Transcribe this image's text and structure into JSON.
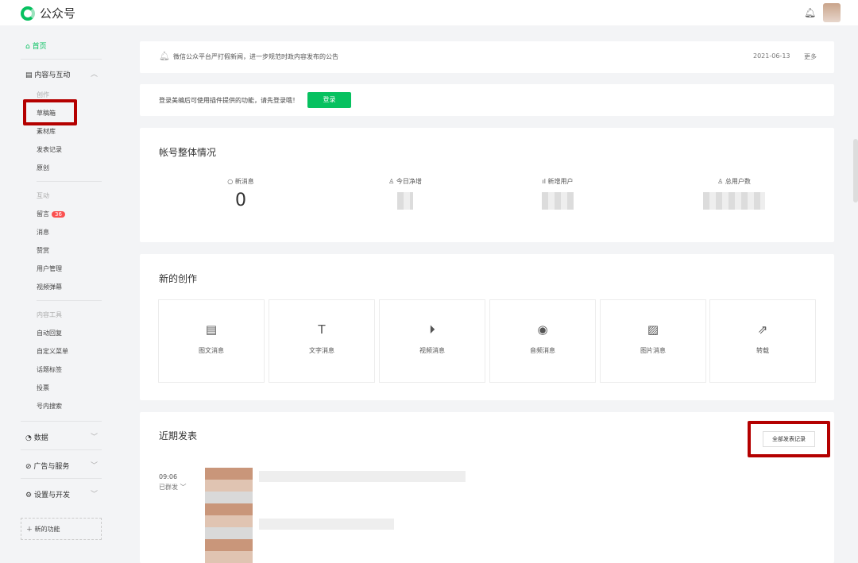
{
  "app": {
    "title": "公众号"
  },
  "sidebar": {
    "home": "首页",
    "content": "内容与互动",
    "groups": {
      "create": "创作",
      "interact": "互动",
      "tools": "内容工具"
    },
    "create_items": [
      "草稿箱",
      "素材库",
      "发表记录",
      "原创"
    ],
    "interact_items": [
      "留言",
      "消息",
      "赞赏",
      "用户管理",
      "视频弹幕"
    ],
    "comment_badge": "36",
    "tool_items": [
      "自动回复",
      "自定义菜单",
      "话题标签",
      "投票",
      "号内搜索"
    ],
    "data": "数据",
    "ads": "广告与服务",
    "settings": "设置与开发",
    "new_feature": "新的功能"
  },
  "notice": {
    "text": "微信公众平台严打假新闻，进一步规范时政内容发布的公告",
    "date": "2021-06-13",
    "more": "更多"
  },
  "login": {
    "text": "登录美编后可使用插件提供的功能，请先登录哦！",
    "button": "登录"
  },
  "account": {
    "title": "帐号整体情况",
    "stats": [
      {
        "label": "新消息",
        "value": "0"
      },
      {
        "label": "今日净增"
      },
      {
        "label": "新增用户"
      },
      {
        "label": "总用户数"
      }
    ]
  },
  "create": {
    "title": "新的创作",
    "tiles": [
      "图文消息",
      "文字消息",
      "视频消息",
      "音频消息",
      "图片消息",
      "转载"
    ]
  },
  "recent": {
    "title": "近期发表",
    "all_button": "全部发表记录",
    "time": "09:06",
    "status": "已群发"
  },
  "colors": {
    "accent": "#07c160",
    "highlight": "#b40000"
  }
}
